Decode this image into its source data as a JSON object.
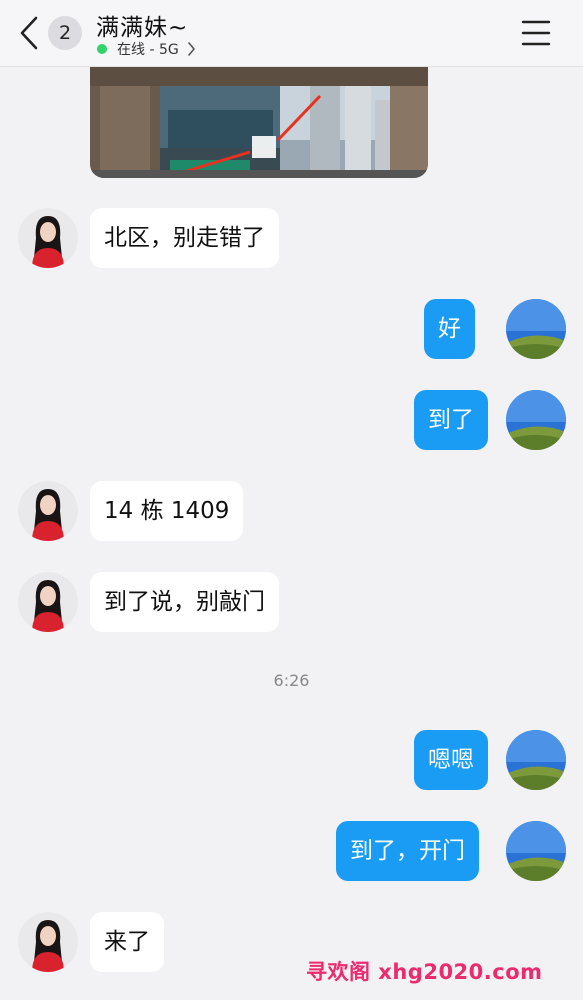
{
  "header": {
    "unread_count": "2",
    "contact_name": "满满妹~",
    "status": "在线 - 5G"
  },
  "messages": [
    {
      "side": "in",
      "text": "北区，别走错了"
    },
    {
      "side": "out",
      "text": "好"
    },
    {
      "side": "out",
      "text": "到了"
    },
    {
      "side": "in",
      "text": "14 栋 1409"
    },
    {
      "side": "in",
      "text": "到了说，别敲门"
    },
    {
      "side": "out",
      "text": "嗯嗯"
    },
    {
      "side": "out",
      "text": "到了，开门"
    },
    {
      "side": "in",
      "text": "来了"
    }
  ],
  "timestamp": "6:26",
  "watermark": "寻欢阁 xhg2020.com",
  "colors": {
    "outgoing_bubble": "#1a9cf5",
    "incoming_bubble": "#ffffff",
    "online_dot": "#2fd46b",
    "watermark": "#ec2a6f"
  }
}
